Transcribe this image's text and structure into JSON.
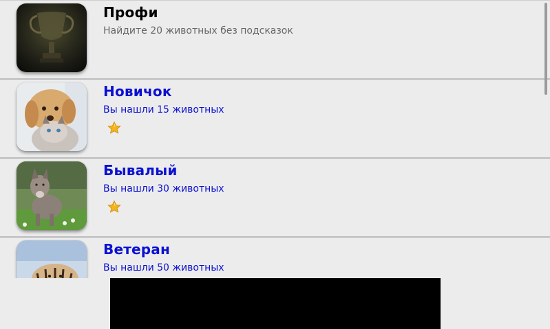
{
  "levels": [
    {
      "title": "Профи",
      "subtitle": "Найдите 20 животных без подсказок",
      "image": "trophy-image",
      "stars": 0
    },
    {
      "title": "Новичок",
      "subtitle": "Вы нашли 15 животных",
      "image": "puppy-kitten-image",
      "stars": 1
    },
    {
      "title": "Бывалый",
      "subtitle": "Вы нашли 30 животных",
      "image": "wolf-image",
      "stars": 1
    },
    {
      "title": "Ветеран",
      "subtitle": "Вы нашли 50 животных",
      "image": "tiger-image",
      "stars": 0
    }
  ],
  "colors": {
    "completed_text": "#0b10d2",
    "locked_title": "#000000",
    "locked_subtitle": "#666666",
    "background": "#ececec",
    "ad_banner": "#000000"
  },
  "icons": {
    "star": "star-icon"
  }
}
